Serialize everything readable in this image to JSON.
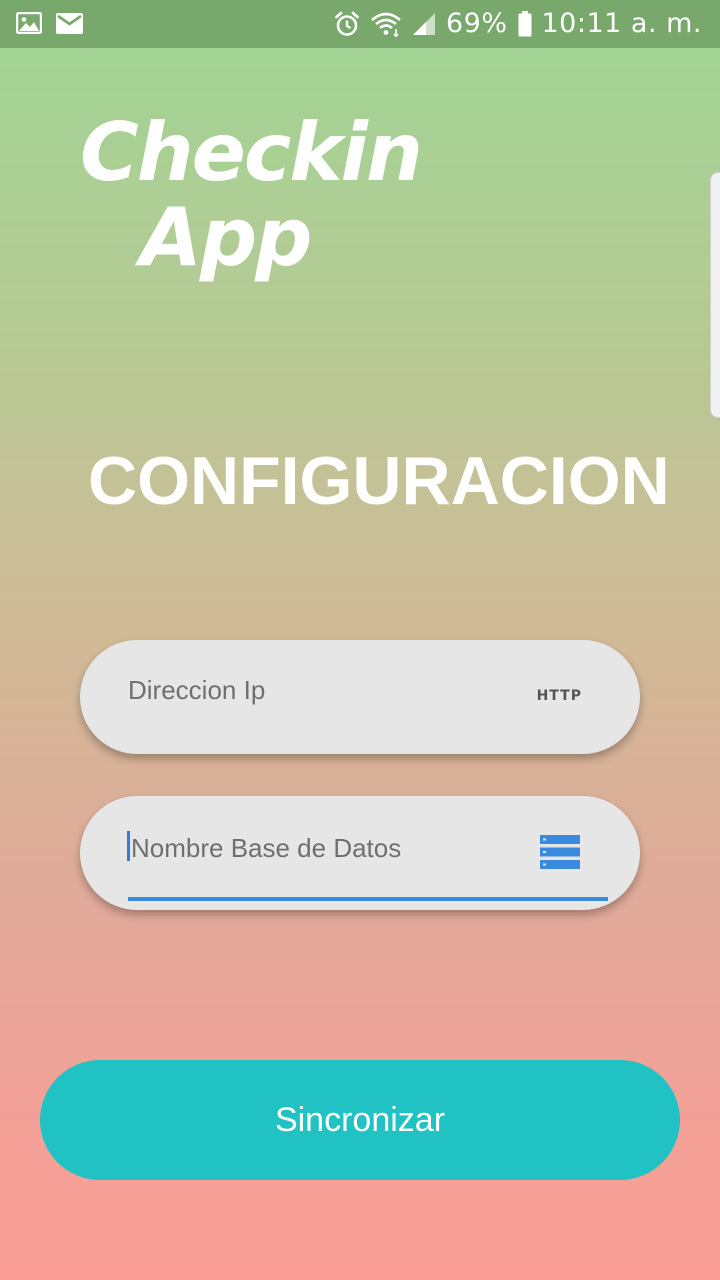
{
  "status_bar": {
    "battery_percent": "69%",
    "time": "10:11 a. m.",
    "icons_left": [
      "gallery-icon",
      "mail-icon"
    ],
    "icons_right": [
      "alarm-icon",
      "wifi-icon",
      "signal-icon",
      "battery-icon"
    ]
  },
  "logo": {
    "line1": "Checkin",
    "line2": "App"
  },
  "title": "CONFIGURACION",
  "form": {
    "ip_field": {
      "placeholder": "Direccion Ip",
      "value": "",
      "icon_text": "HTTP",
      "icon": "http-icon"
    },
    "db_field": {
      "placeholder": "Nombre Base de Datos",
      "value": "",
      "icon": "database-icon",
      "focused": true
    }
  },
  "sync_button": {
    "label": "Sincronizar"
  },
  "colors": {
    "status_bar": "#78a86c",
    "button": "#21c2c4",
    "focus_underline": "#3a8be0",
    "field_background": "#e6e6e6"
  }
}
